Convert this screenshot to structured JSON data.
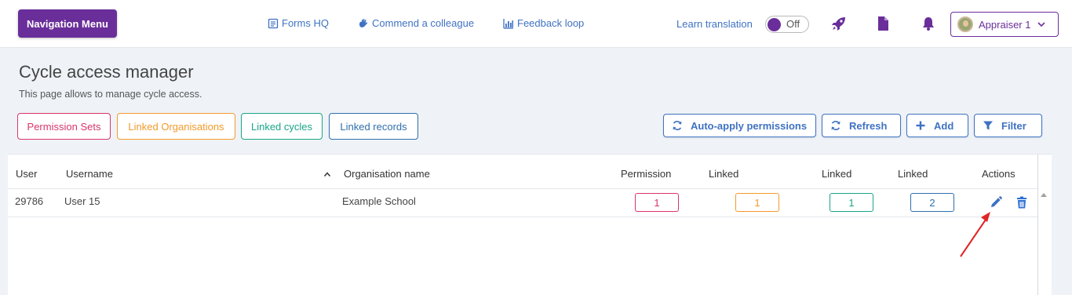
{
  "topbar": {
    "nav_menu_label": "Navigation Menu",
    "links": [
      {
        "label": "Forms HQ",
        "icon": "forms-icon"
      },
      {
        "label": "Commend a colleague",
        "icon": "hand-icon"
      },
      {
        "label": "Feedback loop",
        "icon": "bar-chart-icon"
      }
    ],
    "learn_translation_label": "Learn translation",
    "toggle_state": "Off",
    "user_label": "Appraiser 1"
  },
  "page": {
    "title": "Cycle access manager",
    "subtitle": "This page allows to manage cycle access."
  },
  "tags": [
    {
      "label": "Permission Sets",
      "color": "#d9356a"
    },
    {
      "label": "Linked Organisations",
      "color": "#f39a2b"
    },
    {
      "label": "Linked cycles",
      "color": "#1aa58a"
    },
    {
      "label": "Linked records",
      "color": "#2f6fad"
    }
  ],
  "actions": [
    {
      "label": "Auto-apply permissions",
      "icon": "sync-icon"
    },
    {
      "label": "Refresh",
      "icon": "refresh-icon"
    },
    {
      "label": "Add",
      "icon": "plus-icon"
    },
    {
      "label": "Filter",
      "icon": "filter-icon"
    }
  ],
  "table": {
    "headers": [
      "User",
      "Username",
      "Organisation name",
      "Permission",
      "Linked",
      "Linked",
      "Linked",
      "Actions"
    ],
    "rows": [
      {
        "user": "29786",
        "username": "User 15",
        "organisation": "Example School",
        "permission": "1",
        "linked_orgs": "1",
        "linked_cycles": "1",
        "linked_records": "2"
      }
    ]
  },
  "colors": {
    "brand": "#6a2e9a",
    "link": "#3f72c2",
    "delete": "#2b6fd6",
    "annotation_arrow": "#e02424"
  }
}
